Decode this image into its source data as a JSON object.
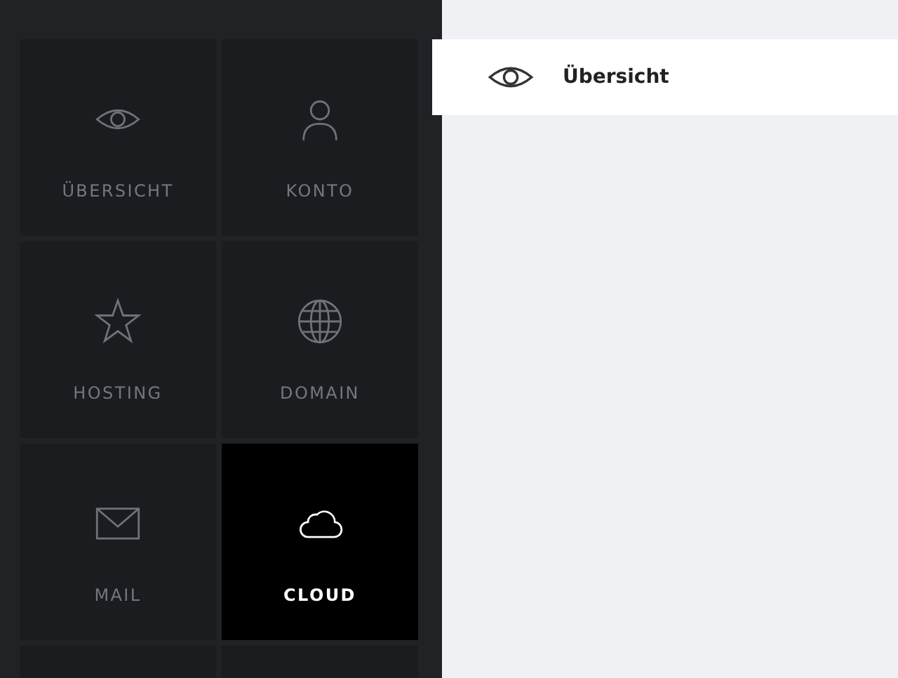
{
  "sidebar": {
    "tiles": [
      {
        "label": "ÜBERSICHT",
        "kind": "eye",
        "selected": false
      },
      {
        "label": "KONTO",
        "kind": "person",
        "selected": false
      },
      {
        "label": "HOSTING",
        "kind": "star",
        "selected": false
      },
      {
        "label": "DOMAIN",
        "kind": "globe",
        "selected": false
      },
      {
        "label": "MAIL",
        "kind": "mail",
        "selected": false
      },
      {
        "label": "CLOUD",
        "kind": "cloud",
        "selected": true
      }
    ]
  },
  "header": {
    "kind": "eye",
    "title": "Übersicht"
  }
}
